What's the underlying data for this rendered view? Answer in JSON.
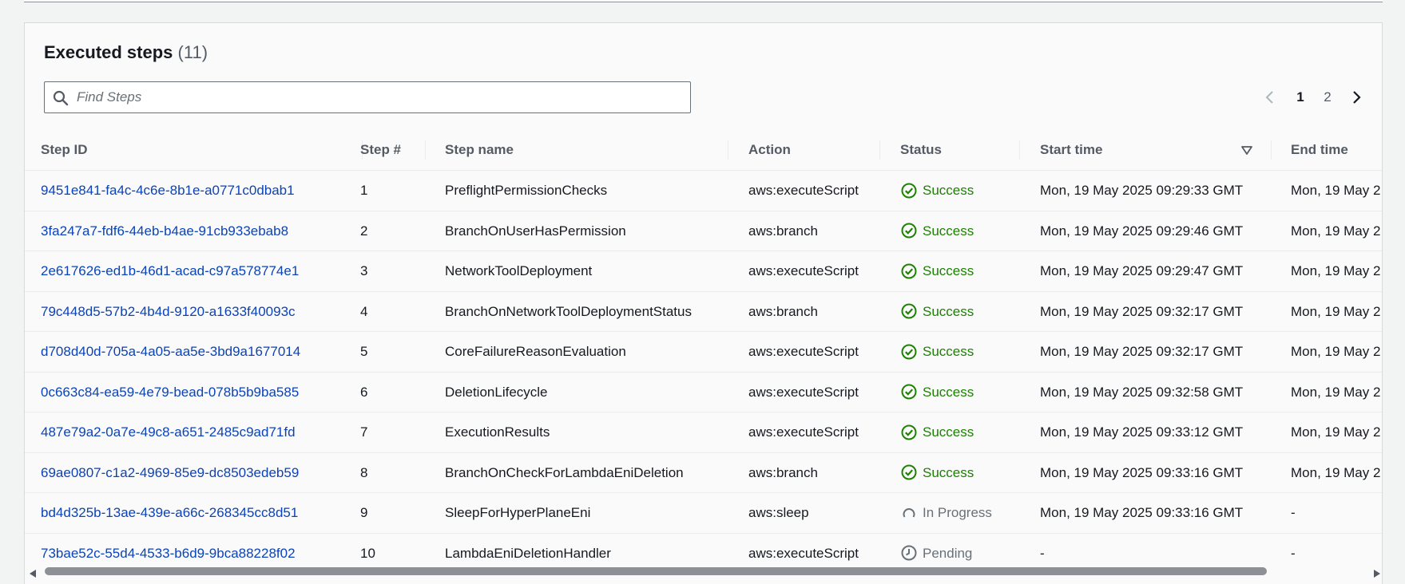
{
  "section": {
    "title": "Executed steps",
    "count": "(11)"
  },
  "search": {
    "placeholder": "Find Steps",
    "value": ""
  },
  "pagination": {
    "pages": [
      "1",
      "2"
    ],
    "current": "1"
  },
  "columns": {
    "step_id": "Step ID",
    "step_num": "Step #",
    "step_name": "Step name",
    "action": "Action",
    "status": "Status",
    "start_time": "Start time",
    "end_time": "End time"
  },
  "sort": {
    "column": "Start time",
    "direction": "descending"
  },
  "rows": [
    {
      "step_id": "9451e841-fa4c-4c6e-8b1e-a0771c0dbab1",
      "num": "1",
      "name": "PreflightPermissionChecks",
      "action": "aws:executeScript",
      "status": "Success",
      "status_type": "success",
      "start": "Mon, 19 May 2025 09:29:33 GMT",
      "end": "Mon, 19 May 2"
    },
    {
      "step_id": "3fa247a7-fdf6-44eb-b4ae-91cb933ebab8",
      "num": "2",
      "name": "BranchOnUserHasPermission",
      "action": "aws:branch",
      "status": "Success",
      "status_type": "success",
      "start": "Mon, 19 May 2025 09:29:46 GMT",
      "end": "Mon, 19 May 2"
    },
    {
      "step_id": "2e617626-ed1b-46d1-acad-c97a578774e1",
      "num": "3",
      "name": "NetworkToolDeployment",
      "action": "aws:executeScript",
      "status": "Success",
      "status_type": "success",
      "start": "Mon, 19 May 2025 09:29:47 GMT",
      "end": "Mon, 19 May 2"
    },
    {
      "step_id": "79c448d5-57b2-4b4d-9120-a1633f40093c",
      "num": "4",
      "name": "BranchOnNetworkToolDeploymentStatus",
      "action": "aws:branch",
      "status": "Success",
      "status_type": "success",
      "start": "Mon, 19 May 2025 09:32:17 GMT",
      "end": "Mon, 19 May 2"
    },
    {
      "step_id": "d708d40d-705a-4a05-aa5e-3bd9a1677014",
      "num": "5",
      "name": "CoreFailureReasonEvaluation",
      "action": "aws:executeScript",
      "status": "Success",
      "status_type": "success",
      "start": "Mon, 19 May 2025 09:32:17 GMT",
      "end": "Mon, 19 May 2"
    },
    {
      "step_id": "0c663c84-ea59-4e79-bead-078b5b9ba585",
      "num": "6",
      "name": "DeletionLifecycle",
      "action": "aws:executeScript",
      "status": "Success",
      "status_type": "success",
      "start": "Mon, 19 May 2025 09:32:58 GMT",
      "end": "Mon, 19 May 2"
    },
    {
      "step_id": "487e79a2-0a7e-49c8-a651-2485c9ad71fd",
      "num": "7",
      "name": "ExecutionResults",
      "action": "aws:executeScript",
      "status": "Success",
      "status_type": "success",
      "start": "Mon, 19 May 2025 09:33:12 GMT",
      "end": "Mon, 19 May 2"
    },
    {
      "step_id": "69ae0807-c1a2-4969-85e9-dc8503edeb59",
      "num": "8",
      "name": "BranchOnCheckForLambdaEniDeletion",
      "action": "aws:branch",
      "status": "Success",
      "status_type": "success",
      "start": "Mon, 19 May 2025 09:33:16 GMT",
      "end": "Mon, 19 May 2"
    },
    {
      "step_id": "bd4d325b-13ae-439e-a66c-268345cc8d51",
      "num": "9",
      "name": "SleepForHyperPlaneEni",
      "action": "aws:sleep",
      "status": "In Progress",
      "status_type": "progress",
      "start": "Mon, 19 May 2025 09:33:16 GMT",
      "end": "-"
    },
    {
      "step_id": "73bae52c-55d4-4533-b6d9-9bca88228f02",
      "num": "10",
      "name": "LambdaEniDeletionHandler",
      "action": "aws:executeScript",
      "status": "Pending",
      "status_type": "pending",
      "start": "-",
      "end": "-"
    }
  ],
  "colors": {
    "link": "#0b43b8",
    "success": "#1d8102",
    "muted": "#687078"
  }
}
